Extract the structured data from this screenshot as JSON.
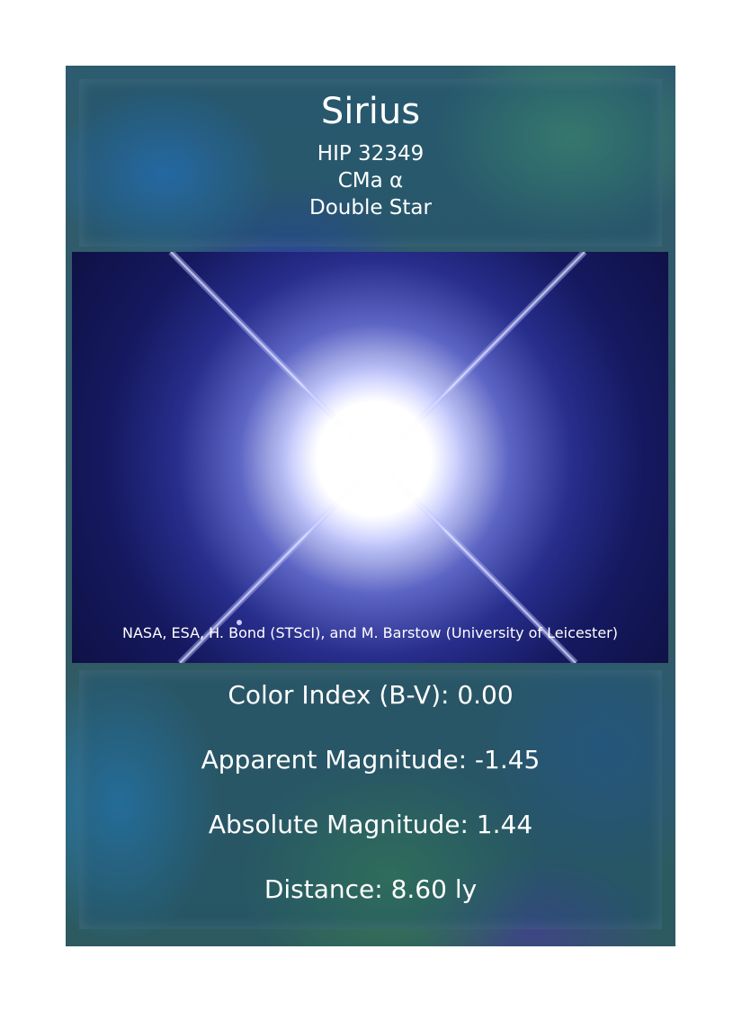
{
  "star": {
    "name": "Sirius",
    "catalog_id": "HIP 32349",
    "designation": "CMa α",
    "type": "Double Star"
  },
  "photo": {
    "credit": "NASA, ESA, H. Bond (STScI), and M. Barstow (University of Leicester)"
  },
  "stats": {
    "color_index": "Color Index (B-V): 0.00",
    "apparent_magnitude": "Apparent Magnitude: -1.45",
    "absolute_magnitude": "Absolute Magnitude: 1.44",
    "distance": "Distance: 8.60 ly"
  },
  "colors": {
    "page_background": "#ffffff",
    "text": "#ffffff",
    "photo_background": "#0e1042",
    "star_glow": "#6f78f0"
  }
}
